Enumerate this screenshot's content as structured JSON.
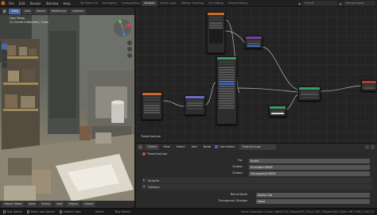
{
  "topbar": {
    "logo_icon": "blender-logo-icon",
    "menus": [
      "File",
      "Edit",
      "Render",
      "Window",
      "Help"
    ],
    "workspaces": [
      "3D View Full",
      "Animation",
      "Compositing",
      "Default",
      "Game Logic",
      "Motion Tracking",
      "UV Editing",
      "Video Editing"
    ],
    "active_workspace": "Default",
    "scene_label": "Scene",
    "render_layer_label": "RenderLayer"
  },
  "viewport": {
    "header_buttons": [
      "View",
      "Add",
      "Select",
      "Reference",
      "Interact"
    ],
    "overlay_lines": [
      "User Persp",
      "(1) Scene Collection | Cube"
    ],
    "mode_label": "Object Mode",
    "view_label": "View",
    "select_label": "Select",
    "add_label": "Add",
    "object_label": "Object",
    "global_label": "Global"
  },
  "node_editor": {
    "node_tree_label": "TrashCanLow"
  },
  "node_header": {
    "editor_icon": "node-editor-icon",
    "object_label": "Object",
    "view_label": "View",
    "select_label": "Select",
    "add_label": "Add",
    "node_label": "Node",
    "use_nodes_label": "Use Nodes",
    "material_label": "TrashCanLow"
  },
  "properties": {
    "material_name": "TrashCanLow",
    "rows": [
      {
        "label": "Fac",
        "value": "Invert"
      },
      {
        "label": "Shader",
        "value": "Principled BSDF"
      },
      {
        "label": "Shader",
        "value": "Transparent BSDF"
      }
    ],
    "panels": [
      {
        "label": "Volume"
      },
      {
        "label": "Options"
      }
    ],
    "blend_mode_label": "Blend Mode",
    "blend_mode_value": "Alpha Clip",
    "transparent_shadow_label": "Transparent Shadow",
    "transparent_shadow_value": "None"
  },
  "status": {
    "left": [
      "Box Select",
      "Move and Attach",
      "Rotate View",
      "Select",
      "Box Select"
    ],
    "right": "Scene Collection | Cube | Verts:710 | Faces:670 | Tris:1,304 | Objects:0/4 | Mem: 66.7 MiB | 2.80.74"
  }
}
